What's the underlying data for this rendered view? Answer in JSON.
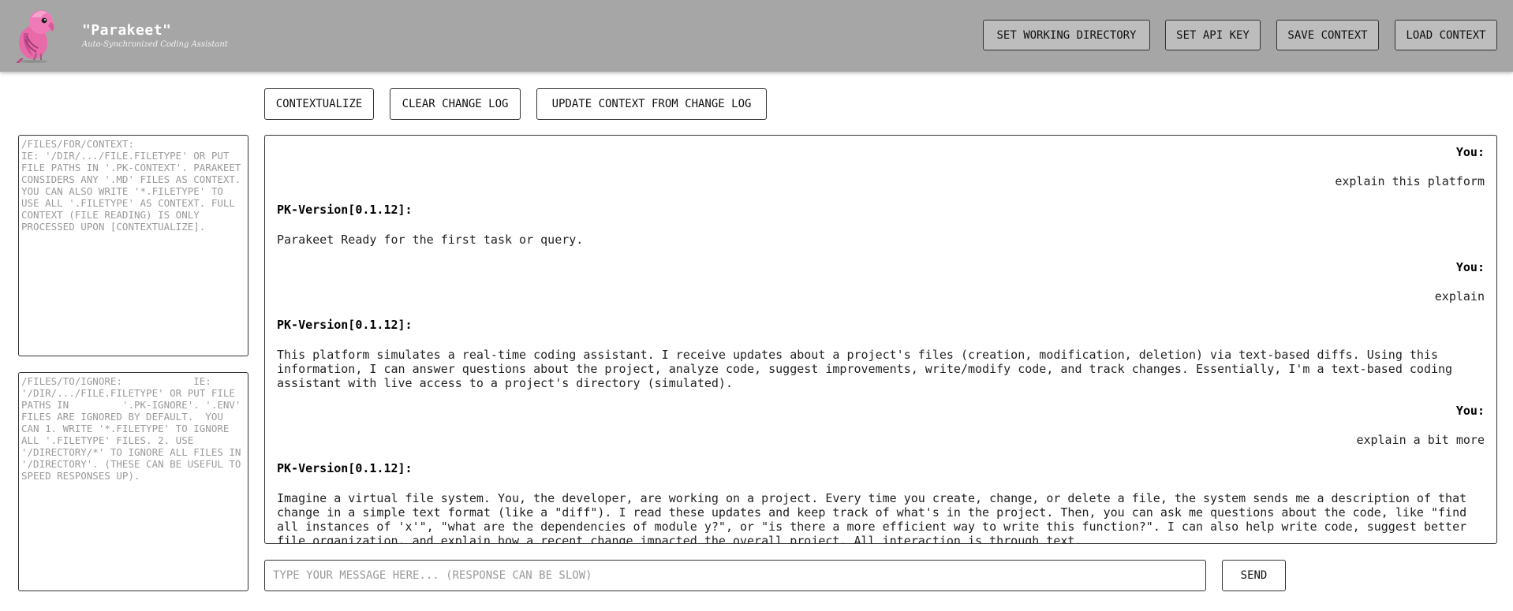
{
  "header": {
    "title": "\"Parakeet\"",
    "subtitle": "Auto-Synchronized Coding Assistant",
    "buttons": {
      "set_working_directory": "SET WORKING DIRECTORY",
      "set_api_key": "SET API KEY",
      "save_context": "SAVE CONTEXT",
      "load_context": "LOAD CONTEXT"
    }
  },
  "toolbar": {
    "contextualize": "CONTEXTUALIZE",
    "clear_change_log": "CLEAR CHANGE LOG",
    "update_context": "UPDATE CONTEXT FROM CHANGE LOG"
  },
  "context_box": {
    "placeholder": "/files/for/context:\nIE: '/dir/.../file.filetype' OR PUT FILE PATHS IN '.pk-context'. PARAKEET CONSIDERS ANY '.md' FILES AS CONTEXT. YOU CAN ALSO WRITE '*.filetype' TO USE ALL '.filetype' AS CONTEXT. FULL CONTEXT (FILE READING) IS ONLY PROCESSED UPON [CONTEXTUALIZE]."
  },
  "ignore_box": {
    "placeholder": "/files/to/ignore:            IE: '/dir/.../file.filetype' OR PUT FILE PATHS IN         '.pk-ignore'. '.env' FILES ARE IGNORED BY DEFAULT.  YOU CAN 1. WRITE '*.filetype' TO IGNORE ALL '.filetype' FILES. 2. USE '/directory/*' TO IGNORE ALL FILES IN '/directory'. (THESE CAN BE USEFUL TO SPEED RESPONSES UP)."
  },
  "chat": {
    "messages": [
      {
        "role": "You:",
        "text": "explain this platform"
      },
      {
        "role": "PK-Version[0.1.12]:",
        "text": "Parakeet Ready for the first task or query."
      },
      {
        "role": "You:",
        "text": "explain"
      },
      {
        "role": "PK-Version[0.1.12]:",
        "text": "This platform simulates a real-time coding assistant. I receive updates about a project's files (creation, modification, deletion) via text-based diffs. Using this information, I can answer questions about the project, analyze code, suggest improvements, write/modify code, and track changes. Essentially, I'm a text-based coding assistant with live access to a project's directory (simulated)."
      },
      {
        "role": "You:",
        "text": "explain a bit more"
      },
      {
        "role": "PK-Version[0.1.12]:",
        "text": "Imagine a virtual file system. You, the developer, are working on a project. Every time you create, change, or delete a file, the system sends me a description of that change in a simple text format (like a \"diff\"). I read these updates and keep track of what's in the project. Then, you can ask me questions about the code, like \"find all instances of 'x'\", \"what are the dependencies of module y?\", or \"is there a more efficient way to write this function?\". I can also help write code, suggest better file organization, and explain how a recent change impacted the overall project. All interaction is through text."
      }
    ]
  },
  "composer": {
    "placeholder": "TYPE YOUR MESSAGE HERE... (RESPONSE CAN BE SLOW)",
    "send_label": "SEND"
  },
  "colors": {
    "header_bg": "#a6a6a6",
    "header_button_bg": "#bdbdbd",
    "parakeet_pink": "#e86aa8"
  }
}
